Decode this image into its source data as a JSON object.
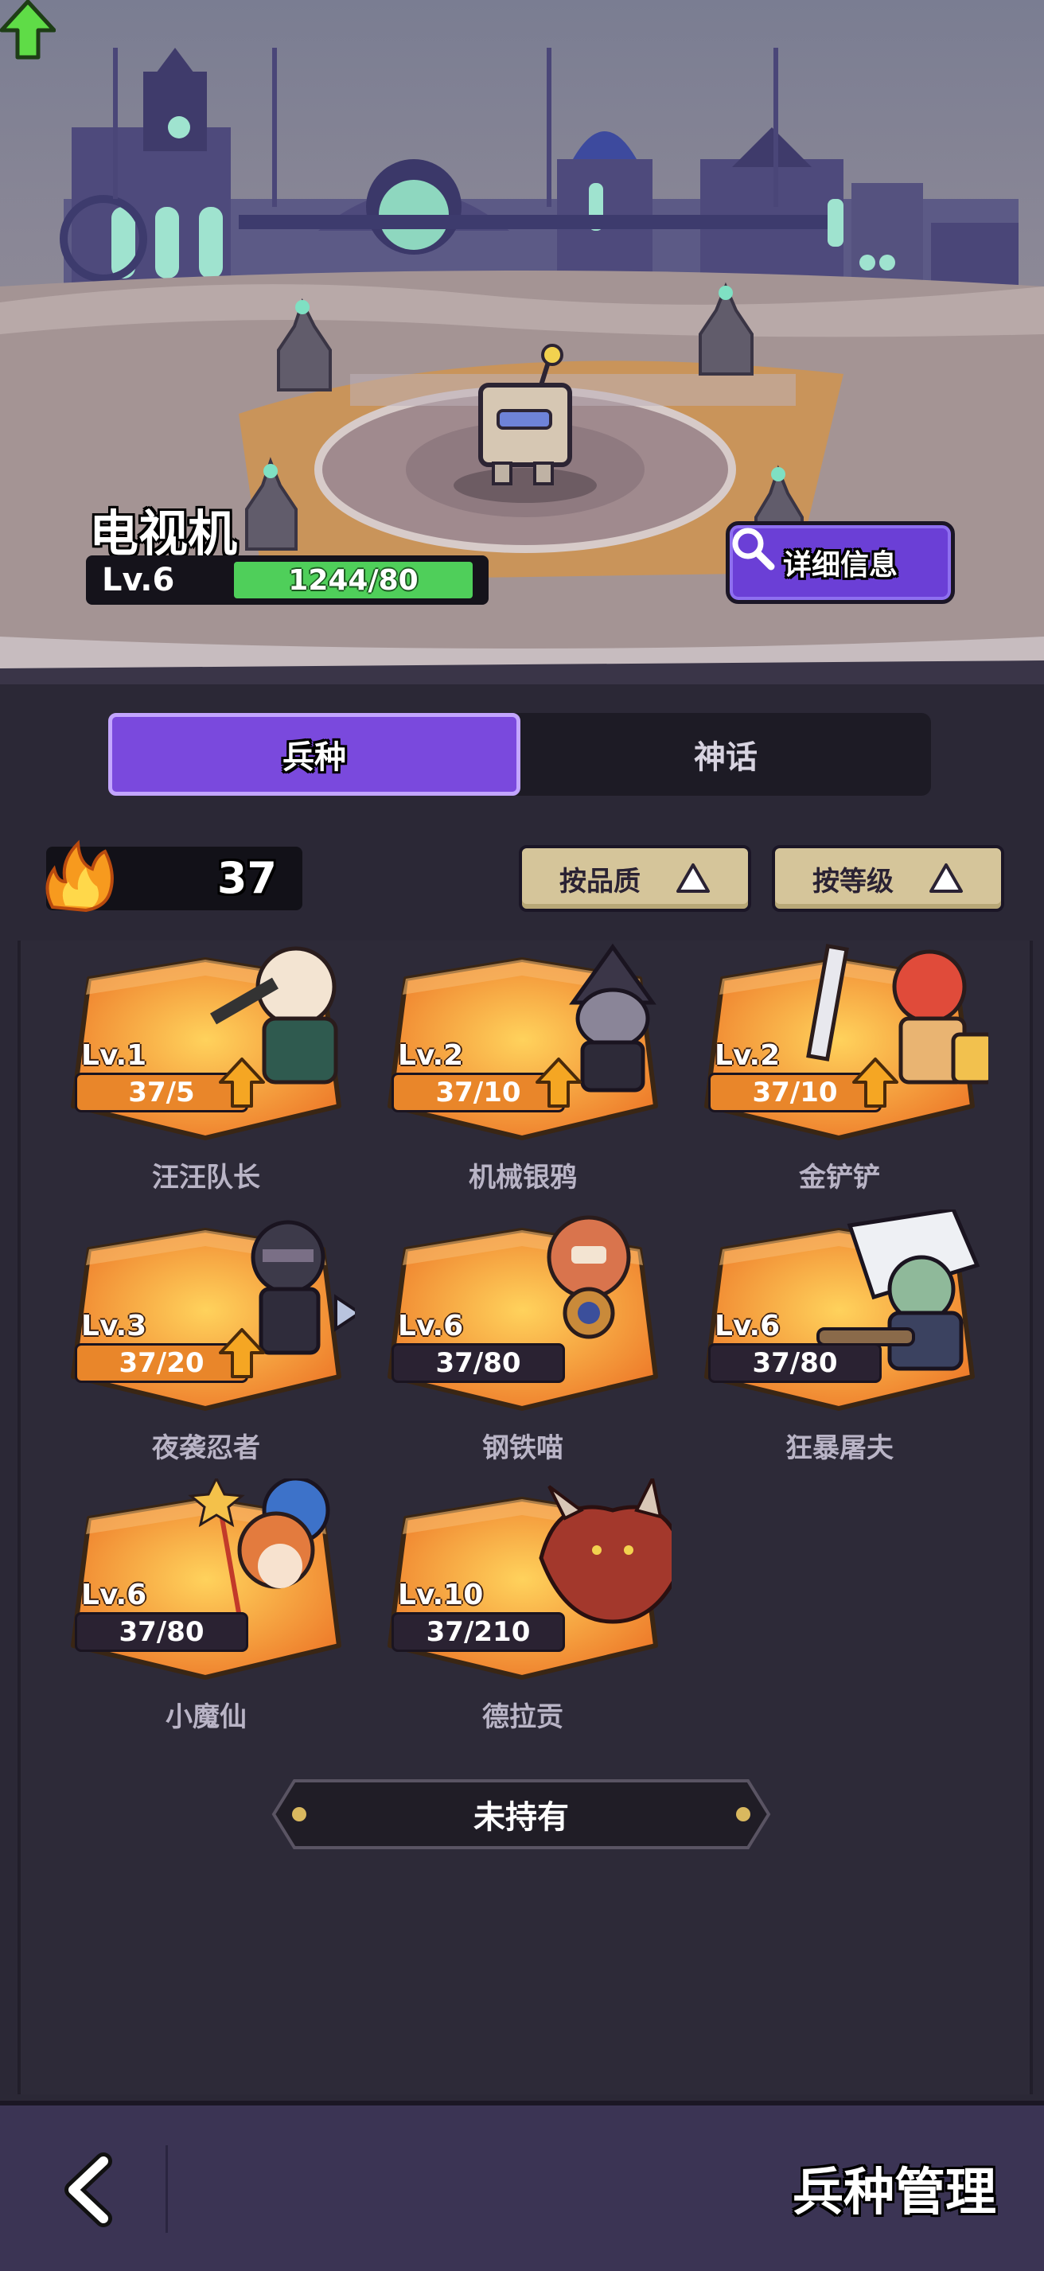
{
  "unit": {
    "name": "电视机",
    "level": "Lv.6",
    "progress": "1244/80",
    "detail_button": "详细信息"
  },
  "tabs": [
    {
      "label": "兵种",
      "active": true
    },
    {
      "label": "神话",
      "active": false
    }
  ],
  "toolbar": {
    "fire_count": "37",
    "sort_quality": "按品质",
    "sort_level": "按等级"
  },
  "cards": [
    {
      "name": "汪汪队长",
      "level": "Lv.1",
      "progress": "37/5",
      "can_upgrade": true
    },
    {
      "name": "机械银鸦",
      "level": "Lv.2",
      "progress": "37/10",
      "can_upgrade": true
    },
    {
      "name": "金铲铲",
      "level": "Lv.2",
      "progress": "37/10",
      "can_upgrade": true
    },
    {
      "name": "夜袭忍者",
      "level": "Lv.3",
      "progress": "37/20",
      "can_upgrade": true
    },
    {
      "name": "钢铁喵",
      "level": "Lv.6",
      "progress": "37/80",
      "can_upgrade": false
    },
    {
      "name": "狂暴屠夫",
      "level": "Lv.6",
      "progress": "37/80",
      "can_upgrade": false
    },
    {
      "name": "小魔仙",
      "level": "Lv.6",
      "progress": "37/80",
      "can_upgrade": false
    },
    {
      "name": "德拉贡",
      "level": "Lv.10",
      "progress": "37/210",
      "can_upgrade": false
    }
  ],
  "not_owned_label": "未持有",
  "footer": {
    "title": "兵种管理",
    "back_icon": "chevron-left-icon"
  },
  "colors": {
    "accent_purple": "#7a49dd",
    "card_orange": "#e9862a",
    "upgrade_green": "#4fcf5a",
    "upgrade_arrow": "#f5a623"
  }
}
